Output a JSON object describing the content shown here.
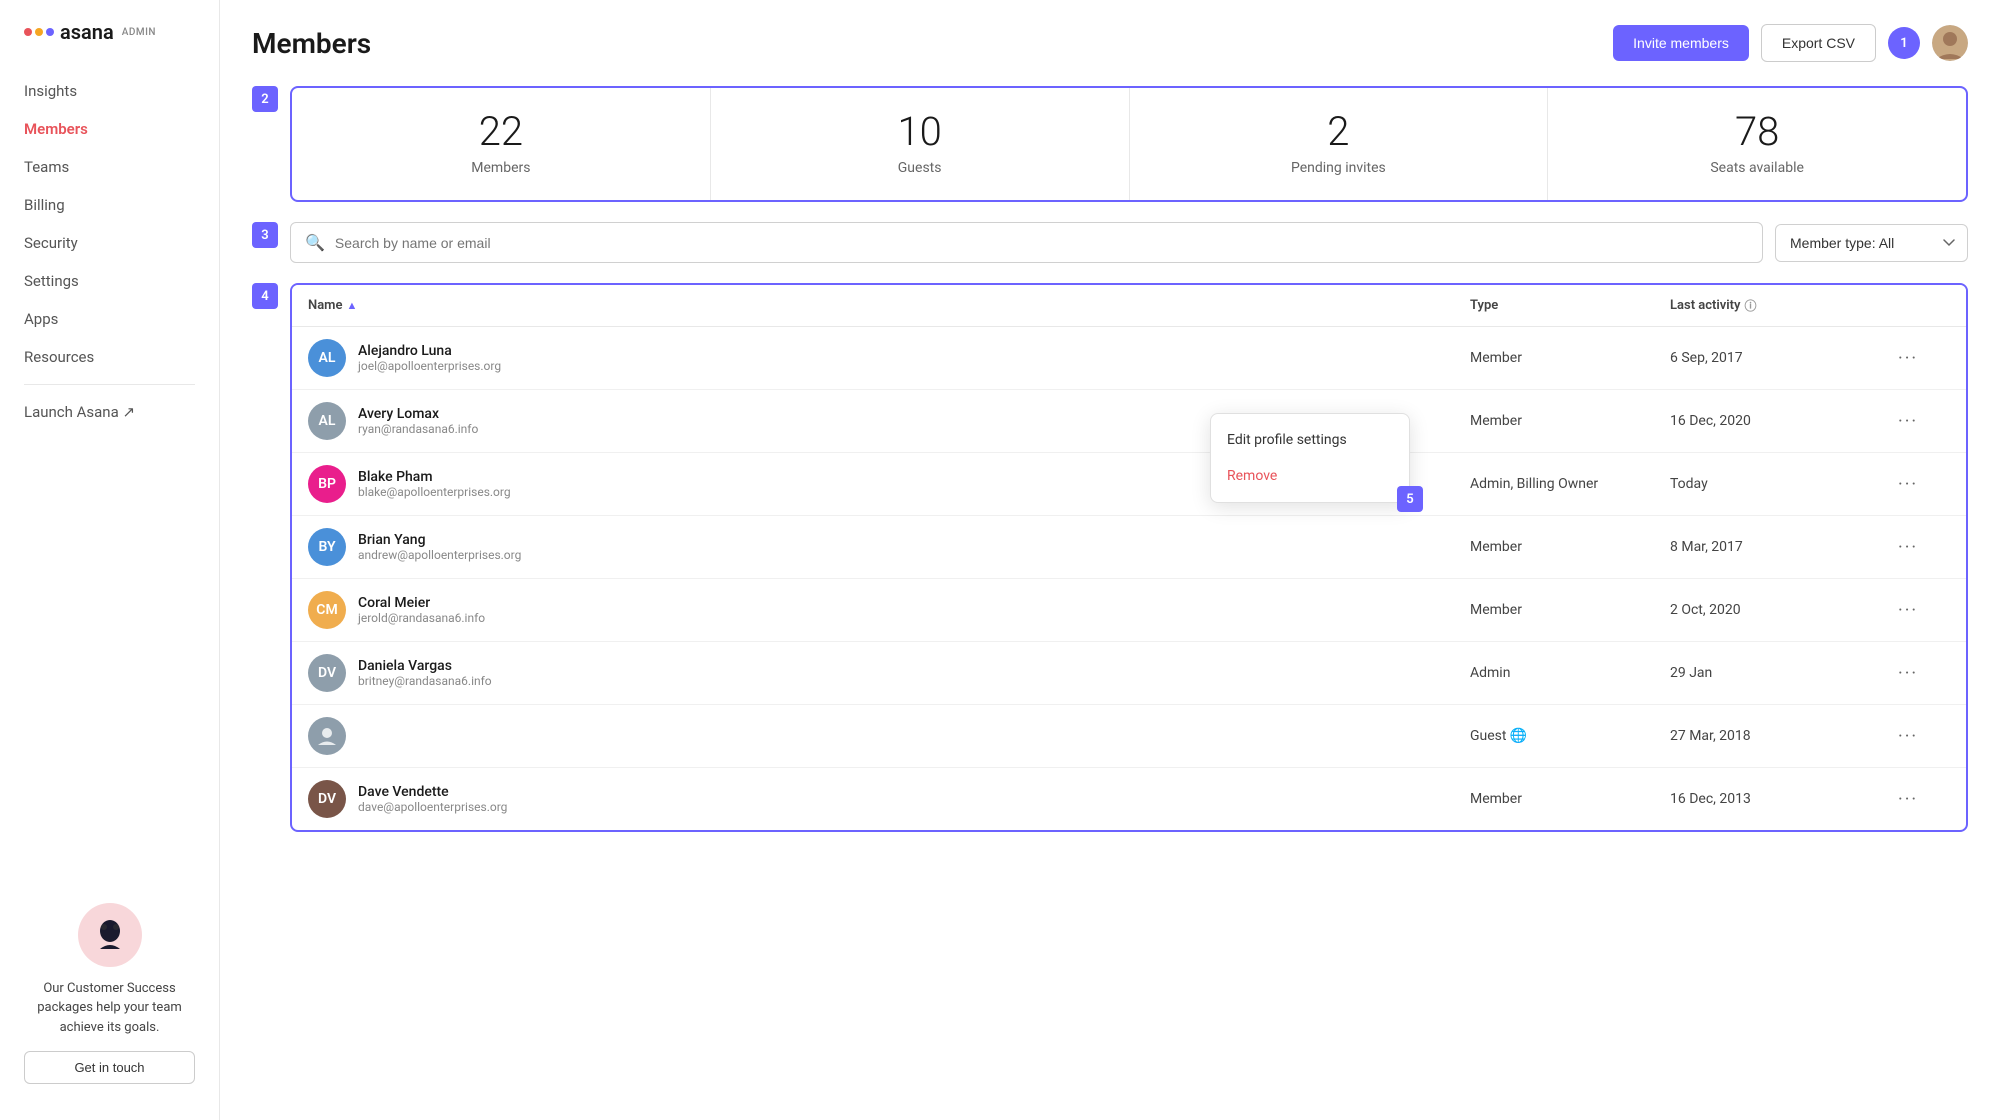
{
  "brand": {
    "name": "asana",
    "admin_label": "ADMIN"
  },
  "sidebar": {
    "nav_items": [
      {
        "id": "insights",
        "label": "Insights",
        "active": false
      },
      {
        "id": "members",
        "label": "Members",
        "active": true
      },
      {
        "id": "teams",
        "label": "Teams",
        "active": false
      },
      {
        "id": "billing",
        "label": "Billing",
        "active": false
      },
      {
        "id": "security",
        "label": "Security",
        "active": false
      },
      {
        "id": "settings",
        "label": "Settings",
        "active": false
      },
      {
        "id": "apps",
        "label": "Apps",
        "active": false
      },
      {
        "id": "resources",
        "label": "Resources",
        "active": false
      }
    ],
    "launch_label": "Launch Asana ↗",
    "success_text": "Our Customer Success packages help your team achieve its goals.",
    "get_in_touch_label": "Get in touch"
  },
  "header": {
    "title": "Members",
    "invite_label": "Invite members",
    "export_label": "Export CSV",
    "user_count_badge": "1"
  },
  "steps": {
    "stats_step": "2",
    "search_step": "3",
    "table_step": "4",
    "dropdown_step": "5"
  },
  "stats": [
    {
      "number": "22",
      "label": "Members"
    },
    {
      "number": "10",
      "label": "Guests"
    },
    {
      "number": "2",
      "label": "Pending invites"
    },
    {
      "number": "78",
      "label": "Seats available"
    }
  ],
  "search": {
    "placeholder": "Search by name or email",
    "filter_label": "Member type: All"
  },
  "table": {
    "columns": [
      {
        "id": "name",
        "label": "Name",
        "sortable": true,
        "sort_dir": "asc"
      },
      {
        "id": "type",
        "label": "Type",
        "sortable": false
      },
      {
        "id": "last_activity",
        "label": "Last activity",
        "info": true
      }
    ],
    "members": [
      {
        "name": "Alejandro Luna",
        "email": "joel@apolloenterprises.org",
        "type": "Member",
        "activity": "6 Sep, 2017",
        "avatar_color": "av-blue",
        "initials": "AL"
      },
      {
        "name": "Avery Lomax",
        "email": "ryan@randasana6.info",
        "type": "Member",
        "activity": "16 Dec, 2020",
        "avatar_color": "av-gray",
        "initials": "AL",
        "has_dropdown": true
      },
      {
        "name": "Blake Pham",
        "email": "blake@apolloenterprises.org",
        "type": "Admin, Billing Owner",
        "activity": "Today",
        "avatar_color": "av-pink",
        "initials": "BP"
      },
      {
        "name": "Brian Yang",
        "email": "andrew@apolloenterprises.org",
        "type": "Member",
        "activity": "8 Mar, 2017",
        "avatar_color": "av-blue",
        "initials": "BY"
      },
      {
        "name": "Coral Meier",
        "email": "jerold@randasana6.info",
        "type": "Member",
        "activity": "2 Oct, 2020",
        "avatar_color": "av-orange",
        "initials": "CM"
      },
      {
        "name": "Daniela Vargas",
        "email": "britney@randasana6.info",
        "type": "Admin",
        "activity": "29 Jan",
        "avatar_color": "av-gray",
        "initials": "DV"
      },
      {
        "name": "",
        "email": "",
        "type": "Guest",
        "activity": "27 Mar, 2018",
        "avatar_color": "av-gray",
        "initials": "",
        "globe": true
      },
      {
        "name": "Dave Vendette",
        "email": "dave@apolloenterprises.org",
        "type": "Member",
        "activity": "16 Dec, 2013",
        "avatar_color": "av-brown",
        "initials": "DV"
      }
    ]
  },
  "dropdown": {
    "edit_label": "Edit profile settings",
    "remove_label": "Remove"
  }
}
